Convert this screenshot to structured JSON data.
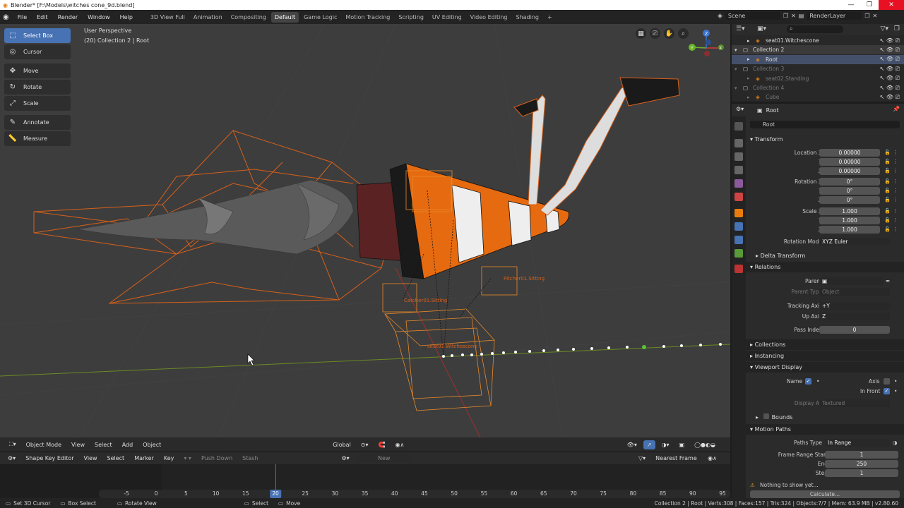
{
  "window": {
    "title": "Blender* [F:\\Models\\witches cone_9d.blend]"
  },
  "menu": [
    "File",
    "Edit",
    "Render",
    "Window",
    "Help"
  ],
  "workspaces": [
    "3D View Full",
    "Animation",
    "Compositing",
    "Default",
    "Game Logic",
    "Motion Tracking",
    "Scripting",
    "UV Editing",
    "Video Editing",
    "Shading"
  ],
  "active_workspace": "Default",
  "scene": {
    "name": "Scene",
    "render_layer": "RenderLayer"
  },
  "viewport": {
    "perspective": "User Perspective",
    "context": "(20) Collection 2 | Root",
    "labels": {
      "catcher": "Catcher01.Sitting",
      "pitcher": "Pitcher01.Sitting",
      "seat": "seat01.Witchescone"
    },
    "axis_labels": {
      "x": "X",
      "y": "Y",
      "z": "Z"
    }
  },
  "tools": [
    "Select Box",
    "Cursor",
    "Move",
    "Rotate",
    "Scale",
    "Annotate",
    "Measure"
  ],
  "vp_header": {
    "mode": "Object Mode",
    "view": "View",
    "select": "Select",
    "add": "Add",
    "object": "Object",
    "orientation": "Global"
  },
  "shape_key": {
    "editor": "Shape Key Editor",
    "view": "View",
    "select": "Select",
    "marker": "Marker",
    "key": "Key",
    "push_down": "Push Down",
    "stash": "Stash",
    "new": "New",
    "snap": "Nearest Frame"
  },
  "timeline": {
    "frames": [
      "-5",
      "0",
      "5",
      "10",
      "15",
      "20",
      "25",
      "30",
      "35",
      "40",
      "45",
      "50",
      "55",
      "60",
      "65",
      "70",
      "75",
      "80",
      "85",
      "90",
      "95"
    ],
    "current": "20"
  },
  "outliner": [
    {
      "name": "seat01.Witchescone",
      "indent": 1,
      "dim": false
    },
    {
      "name": "Collection 2",
      "indent": 0,
      "dim": false
    },
    {
      "name": "Root",
      "indent": 1,
      "dim": false
    },
    {
      "name": "Collection 3",
      "indent": 0,
      "dim": true
    },
    {
      "name": "seat02.Standing",
      "indent": 1,
      "dim": true
    },
    {
      "name": "Collection 4",
      "indent": 0,
      "dim": true
    },
    {
      "name": "Cube",
      "indent": 1,
      "dim": true
    }
  ],
  "props": {
    "object_name": "Root",
    "object_field": "Root",
    "transform": "Transform",
    "location_x_label": "Location X",
    "y_label": "Y",
    "z_label": "Z",
    "location": [
      "0.00000",
      "0.00000",
      "0.00000"
    ],
    "rotation_x_label": "Rotation X",
    "rotation": [
      "0°",
      "0°",
      "0°"
    ],
    "scale_x_label": "Scale X",
    "scale": [
      "1.000",
      "1.000",
      "1.000"
    ],
    "rotation_mode_label": "Rotation Mode",
    "rotation_mode": "XYZ Euler",
    "delta_transform": "Delta Transform",
    "relations": "Relations",
    "parent_label": "Parent",
    "parent_type_label": "Parent Type",
    "parent_type": "Object",
    "tracking_axis_label": "Tracking Axis",
    "tracking_axis": "+Y",
    "up_axis_label": "Up Axis",
    "up_axis": "Z",
    "pass_index_label": "Pass Index",
    "pass_index": "0",
    "collections": "Collections",
    "instancing": "Instancing",
    "viewport_display": "Viewport Display",
    "name_label": "Name",
    "axis_label": "Axis",
    "in_front_label": "In Front",
    "display_as_label": "Display As",
    "display_as": "Textured",
    "bounds": "Bounds",
    "motion_paths": "Motion Paths",
    "paths_type_label": "Paths Type",
    "paths_type": "In Range",
    "frame_range_start_label": "Frame Range Start",
    "frame_range_start": "1",
    "end_label": "End",
    "end": "250",
    "step_label": "Step",
    "step": "1",
    "nothing": "Nothing to show yet...",
    "calculate": "Calculate..."
  },
  "status": {
    "set_cursor": "Set 3D Cursor",
    "box_select": "Box Select",
    "rotate_view": "Rotate View",
    "select": "Select",
    "move": "Move",
    "stats": "Collection 2 | Root | Verts:308 | Faces:157 | Tris:324 | Objects:7/7 | Mem: 63.9 MB | v2.80.60"
  },
  "colors": {
    "accent": "#4772b3",
    "selection": "#e8721c",
    "viewport_bg": "#3d3d3d"
  }
}
